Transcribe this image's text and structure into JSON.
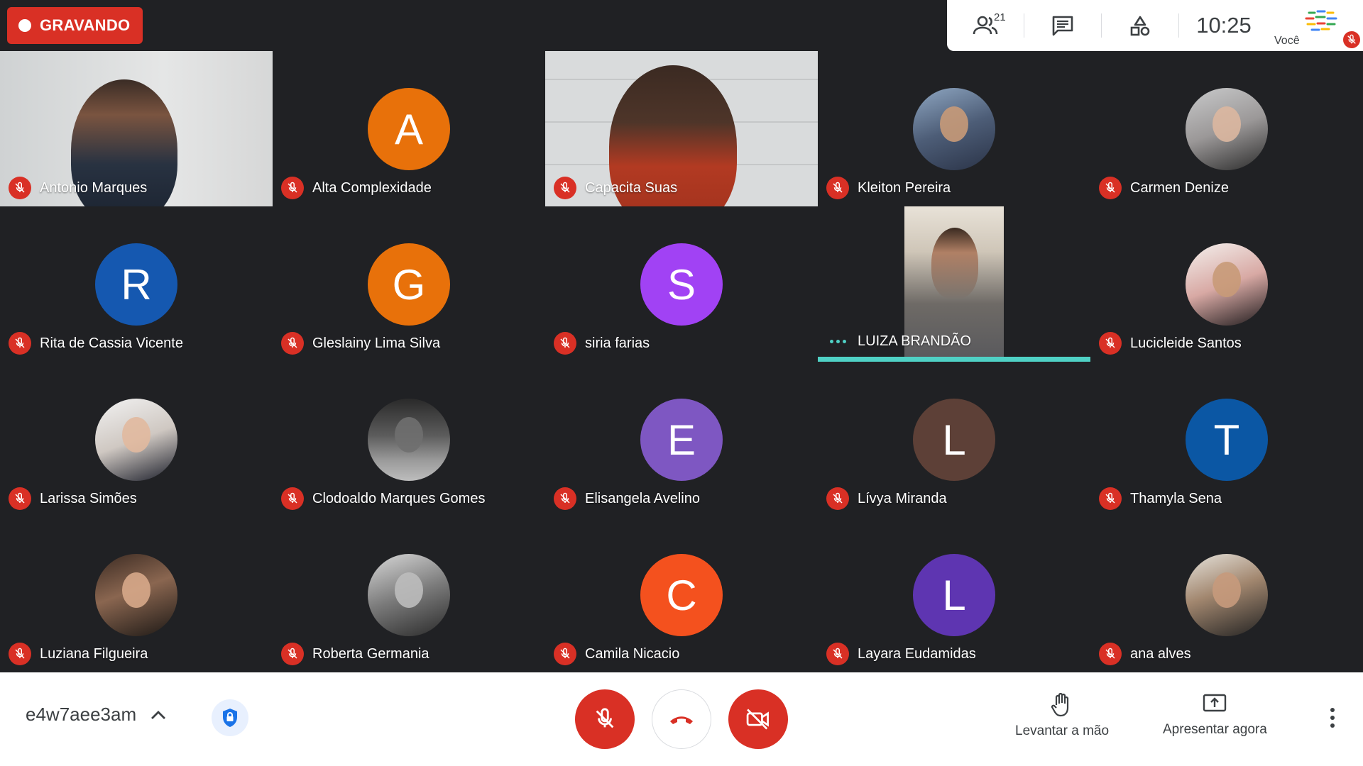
{
  "recording": {
    "label": "GRAVANDO"
  },
  "top_panel": {
    "participants_icon": "people-icon",
    "participants_count": "21",
    "chat_icon": "chat-icon",
    "activities_icon": "activities-icon",
    "clock": "10:25",
    "self_label": "Você",
    "self_mic_icon": "mic-off-icon"
  },
  "tiles": [
    {
      "name": "Antonio Marques",
      "kind": "video"
    },
    {
      "name": "Alta Complexidade",
      "kind": "initial",
      "initial": "A",
      "color": "#e8710a"
    },
    {
      "name": "Capacita Suas",
      "kind": "video"
    },
    {
      "name": "Kleiton Pereira",
      "kind": "photo"
    },
    {
      "name": "Carmen Denize",
      "kind": "photo"
    },
    {
      "name": "Rita de Cassia Vicente",
      "kind": "initial",
      "initial": "R",
      "color": "#1558b0"
    },
    {
      "name": "Gleslainy Lima Silva",
      "kind": "initial",
      "initial": "G",
      "color": "#e8710a"
    },
    {
      "name": "siria farias",
      "kind": "initial",
      "initial": "S",
      "color": "#a142f4"
    },
    {
      "name": "LUIZA BRANDÃO",
      "kind": "video",
      "speaking": true
    },
    {
      "name": "Lucicleide Santos",
      "kind": "photo"
    },
    {
      "name": "Larissa Simões",
      "kind": "photo"
    },
    {
      "name": "Clodoaldo Marques Gomes",
      "kind": "photo"
    },
    {
      "name": "Elisangela Avelino",
      "kind": "initial",
      "initial": "E",
      "color": "#7e57c2"
    },
    {
      "name": "Lívya Miranda",
      "kind": "initial",
      "initial": "L",
      "color": "#5d4037"
    },
    {
      "name": "Thamyla Sena",
      "kind": "initial",
      "initial": "T",
      "color": "#0b57a4"
    },
    {
      "name": "Luziana Filgueira",
      "kind": "photo"
    },
    {
      "name": "Roberta Germania",
      "kind": "photo"
    },
    {
      "name": "Camila Nicacio",
      "kind": "initial",
      "initial": "C",
      "color": "#f4511e"
    },
    {
      "name": "Layara Eudamidas",
      "kind": "initial",
      "initial": "L",
      "color": "#5e35b1"
    },
    {
      "name": "ana alves",
      "kind": "photo"
    }
  ],
  "bottom_bar": {
    "meeting_code": "e4w7aee3am",
    "mic_icon": "mic-off-icon",
    "hangup_icon": "phone-hangup-icon",
    "camera_icon": "camera-off-icon",
    "raise_hand": "Levantar a mão",
    "present": "Apresentar agora",
    "more_icon": "more-vert-icon"
  },
  "colors": {
    "accent_red": "#d93025",
    "speaking": "#4fd1c5"
  }
}
